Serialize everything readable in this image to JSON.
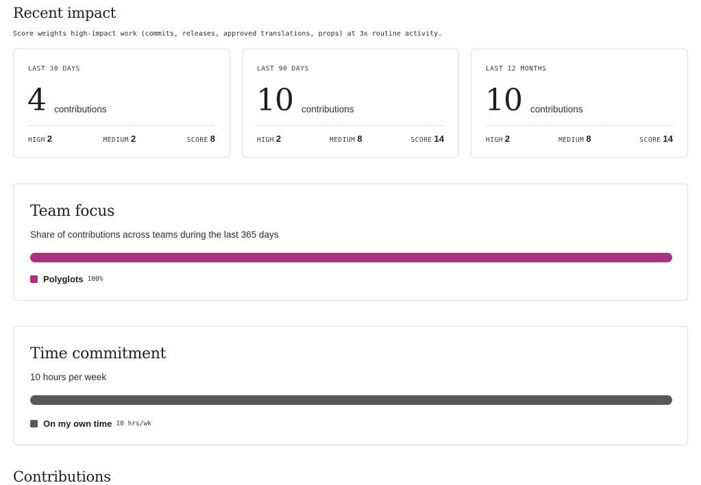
{
  "recent_impact": {
    "title": "Recent impact",
    "subtitle": "Score weights high-impact work (commits, releases, approved translations, props) at 3x routine activity.",
    "cards": [
      {
        "period": "LAST 30 DAYS",
        "count": "4",
        "unit": "contributions",
        "high_label": "HIGH",
        "high": "2",
        "medium_label": "MEDIUM",
        "medium": "2",
        "score_label": "SCORE",
        "score": "8"
      },
      {
        "period": "LAST 90 DAYS",
        "count": "10",
        "unit": "contributions",
        "high_label": "HIGH",
        "high": "2",
        "medium_label": "MEDIUM",
        "medium": "8",
        "score_label": "SCORE",
        "score": "14"
      },
      {
        "period": "LAST 12 MONTHS",
        "count": "10",
        "unit": "contributions",
        "high_label": "HIGH",
        "high": "2",
        "medium_label": "MEDIUM",
        "medium": "8",
        "score_label": "SCORE",
        "score": "14"
      }
    ]
  },
  "team_focus": {
    "title": "Team focus",
    "subtitle": "Share of contributions across teams during the last 365 days",
    "bar_color": "#b0307f",
    "bar_fill": 1.0,
    "legend": {
      "name": "Polyglots",
      "value": "100%"
    }
  },
  "time_commitment": {
    "title": "Time commitment",
    "subtitle": "10 hours per week",
    "bar_color": "#55585d",
    "bar_fill": 1.0,
    "legend": {
      "name": "On my own time",
      "value": "10 hrs/wk"
    }
  },
  "contributions": {
    "title": "Contributions"
  }
}
